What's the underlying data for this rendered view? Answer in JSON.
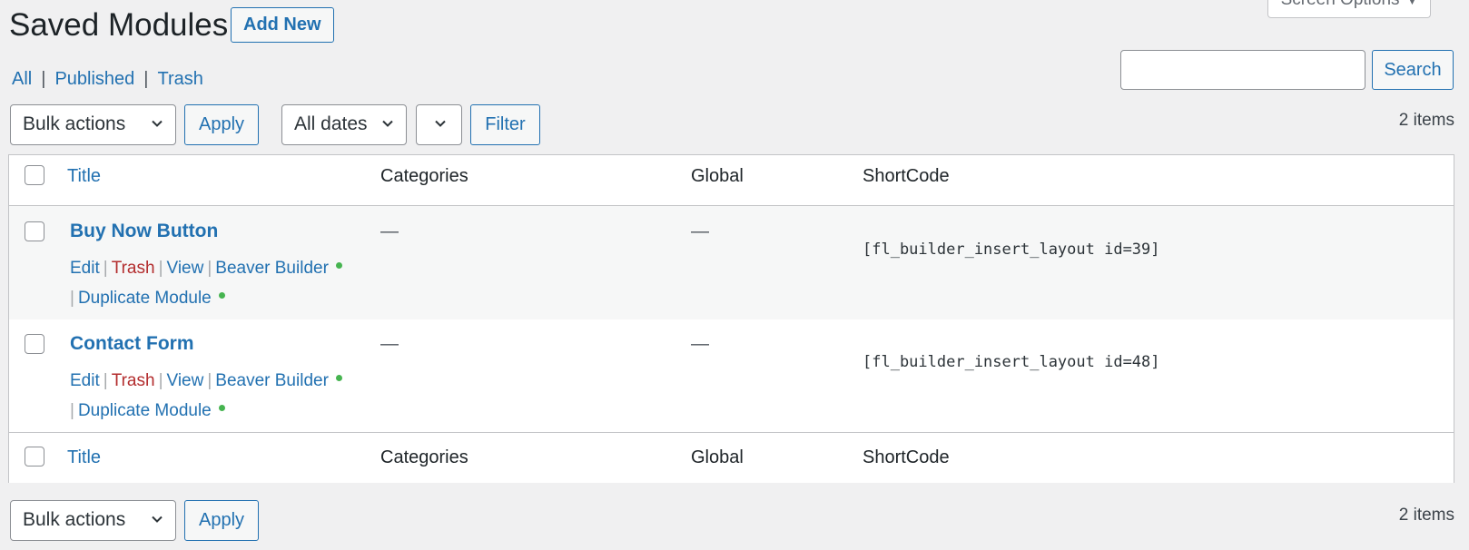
{
  "header": {
    "title": "Saved Modules",
    "add_new_label": "Add New",
    "screen_options_label": "Screen Options"
  },
  "views": {
    "all": "All",
    "published": "Published",
    "trash": "Trash",
    "separator": "|"
  },
  "search": {
    "value": "",
    "button_label": "Search"
  },
  "tablenav_top": {
    "bulk_actions": "Bulk actions",
    "apply_label": "Apply",
    "dates": "All dates",
    "filter_label": "Filter",
    "item_count": "2 items"
  },
  "table": {
    "columns": {
      "title": "Title",
      "categories": "Categories",
      "global": "Global",
      "shortcode": "ShortCode"
    },
    "rows": [
      {
        "title": "Buy Now Button",
        "categories": "—",
        "global": "—",
        "shortcode": "[fl_builder_insert_layout id=39]",
        "actions": {
          "edit": "Edit",
          "trash": "Trash",
          "view": "View",
          "beaver_builder": "Beaver Builder",
          "duplicate": "Duplicate Module"
        }
      },
      {
        "title": "Contact Form",
        "categories": "—",
        "global": "—",
        "shortcode": "[fl_builder_insert_layout id=48]",
        "actions": {
          "edit": "Edit",
          "trash": "Trash",
          "view": "View",
          "beaver_builder": "Beaver Builder",
          "duplicate": "Duplicate Module"
        }
      }
    ]
  },
  "tablenav_bottom": {
    "bulk_actions": "Bulk actions",
    "apply_label": "Apply",
    "item_count": "2 items"
  },
  "colors": {
    "link": "#2271b1",
    "trash": "#b32d2e",
    "status_dot": "#46b450",
    "background": "#f0f0f1"
  }
}
